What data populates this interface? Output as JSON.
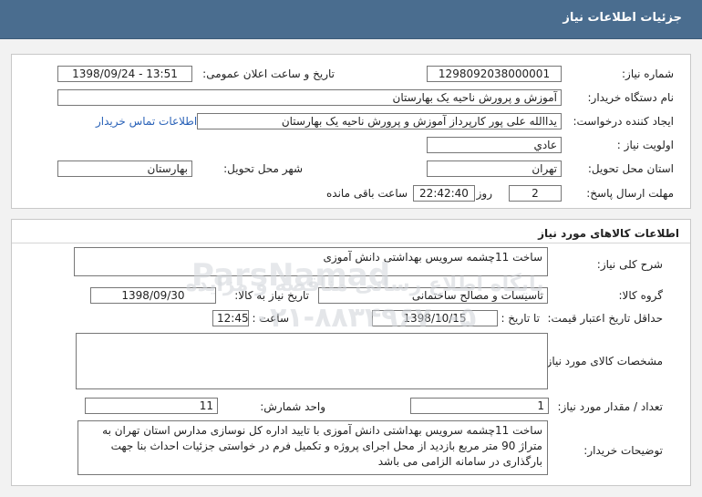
{
  "header": {
    "title": "جزئیات اطلاعات نیاز"
  },
  "need_info": {
    "need_number_label": "شماره نیاز:",
    "need_number": "1298092038000001",
    "announce_label": "تاریخ و ساعت اعلان عمومی:",
    "announce_value": "1398/09/24 - 13:51",
    "buyer_org_label": "نام دستگاه خریدار:",
    "buyer_org": "آموزش و پرورش ناحیه یک بهارستان",
    "requester_label": "ایجاد کننده درخواست:",
    "requester": "یداالله علی پور  کارپرداز آموزش و پرورش ناحیه یک بهارستان",
    "contact_link": "اطلاعات تماس خریدار",
    "priority_label": "اولویت نیاز :",
    "priority": "عادي",
    "province_label": "استان محل تحویل:",
    "province": "تهران",
    "city_label": "شهر محل تحویل:",
    "city": "بهارستان",
    "deadline_label": "مهلت ارسال پاسخ:",
    "deadline_days": "2",
    "days_word": "روز و",
    "deadline_time": "22:42:40",
    "remaining_word": "ساعت باقی مانده"
  },
  "goods": {
    "section_title": "اطلاعات کالاهای مورد نیاز",
    "general_desc_label": "شرح کلی نیاز:",
    "general_desc": "ساخت 11چشمه سرویس بهداشتی دانش آموزی",
    "group_label": "گروه کالا:",
    "group": "تاسیسات و مصالح ساختمانی",
    "need_date_label": "تاریخ نیاز به کالا:",
    "need_date": "1398/09/30",
    "validity_label": "حداقل تاریخ اعتبار قیمت:",
    "until_date_label": "تا تاریخ :",
    "until_date": "1398/10/15",
    "time_label": "ساعت :",
    "time": "12:45",
    "specs_label": "مشخصات کالای مورد نیاز:",
    "qty_label": "تعداد / مقدار مورد نیاز:",
    "qty": "1",
    "unit_label": "واحد شمارش:",
    "unit": "11",
    "buyer_notes_label": "توضیحات خریدار:",
    "buyer_notes": "ساخت 11چشمه سرویس بهداشتی دانش آموزی با تایید اداره کل نوسازی مدارس استان تهران به متراژ 90 متر مربع بازدید از محل اجرای پروژه و تکمیل فرم در خواستی جزئیات احداث بنا جهت بارگذاری در سامانه الزامی می باشد"
  },
  "watermark": {
    "logo": "ParsNamad",
    "line1": "پایگاه اطلاع رسانی مناقصه و مزایده",
    "line2": "۰۲۱-۸۸۳۴۹۶۷۰-۵"
  }
}
